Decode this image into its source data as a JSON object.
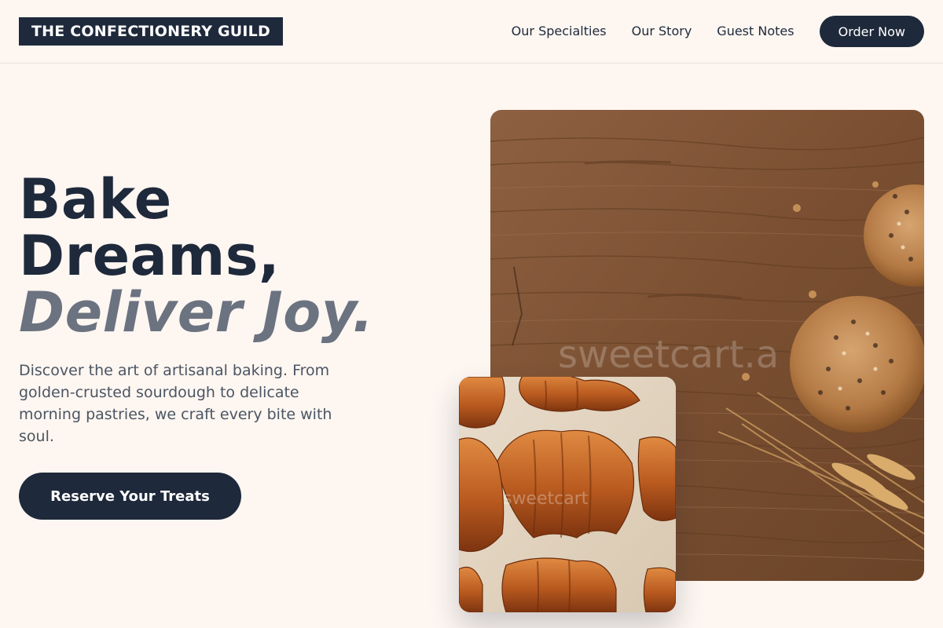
{
  "header": {
    "logo": "THE CONFECTIONERY GUILD",
    "nav": [
      "Our Specialties",
      "Our Story",
      "Guest Notes"
    ],
    "cta": "Order Now"
  },
  "hero": {
    "headline_line1": "Bake",
    "headline_line2": "Dreams,",
    "headline_accent": "Deliver Joy.",
    "subtext": "Discover the art of artisanal baking. From golden-crusted sourdough to delicate morning pastries, we craft every bite with soul.",
    "cta": "Reserve Your Treats"
  },
  "images": {
    "main": {
      "subject": "round seeded bread loaves and wheat stalks on rustic wooden table",
      "watermark": "sweetcart.a"
    },
    "secondary": {
      "subject": "baked croissants on parchment paper",
      "watermark": "sweetcart"
    }
  },
  "colors": {
    "background": "#fdf6f1",
    "primary": "#1e293b",
    "accent_text": "#6b7280",
    "body_text": "#4b5563",
    "wood": "#8b5a36"
  }
}
